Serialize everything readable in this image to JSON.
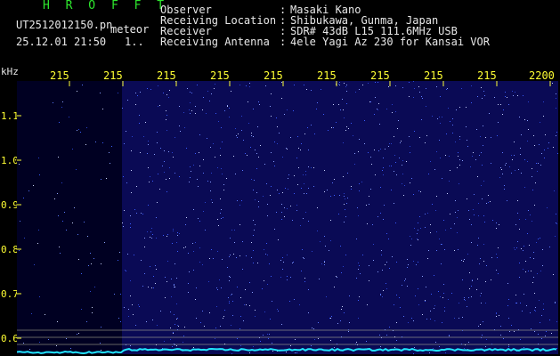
{
  "header": {
    "brand": "H R O F F T",
    "filename": "UT2512012150.pn",
    "type_tag": "meteor",
    "datetime": "25.12.01 21:50",
    "extra": "1..",
    "fields": [
      {
        "label": "Observer",
        "colon": ":",
        "value": "Masaki Kano"
      },
      {
        "label": "Receiving Location",
        "colon": ":",
        "value": "Shibukawa, Gunma, Japan"
      },
      {
        "label": "Receiver",
        "colon": ":",
        "value": "SDR# 43dB L15 111.6MHz USB"
      },
      {
        "label": "Receiving Antenna",
        "colon": ":",
        "value": "4ele Yagi Az 230 for Kansai VOR"
      }
    ]
  },
  "axes": {
    "y_unit": "kHz",
    "time_ticks": [
      "215",
      "215",
      "215",
      "215",
      "215",
      "215",
      "215",
      "215",
      "215",
      "2200"
    ],
    "freq_ticks": [
      "1.1",
      "1.0",
      "0.9",
      "0.8",
      "0.7",
      "0.6"
    ]
  },
  "colors": {
    "background": "#000000",
    "plot": "#0a0a55",
    "noise": "#3a5cff",
    "tick": "#ffff33",
    "trace": "#22e6ff",
    "brand": "#2ee82e"
  }
}
